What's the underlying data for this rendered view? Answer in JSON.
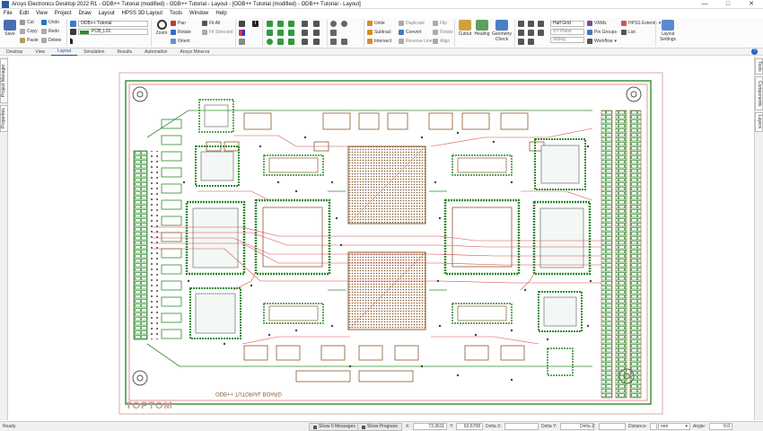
{
  "window": {
    "title": "Ansys Electronics Desktop 2022 R1 - ODB++ Tutorial (modified) - ODB++ Tutorial - Layout - [ODB++ Tutorial (modified) - ODB++ Tutorial - Layout]",
    "minimize": "—",
    "maximize": "□",
    "close": "✕"
  },
  "menu": [
    "File",
    "Edit",
    "View",
    "Project",
    "Draw",
    "Layout",
    "HPSS 3D Layout",
    "Tools",
    "Window",
    "Help"
  ],
  "ribbon": {
    "save": "Save",
    "cut": "Cut",
    "copy": "Copy",
    "paste": "Paste",
    "undo": "Undo",
    "redo": "Redo",
    "delete": "Delete",
    "design_select": "ODB++ Tutorial",
    "layer_select": "PCB_L01",
    "zoom": "Zoom",
    "pan": "Pan",
    "rotate": "Rotate",
    "orient": "Orient",
    "fit_all": "Fit All",
    "fit_selected": "Fit Selected",
    "unite": "Unite",
    "subtract": "Subtract",
    "intersect": "Intersect",
    "duplicate": "Duplicate",
    "convert": "Convert",
    "reverse_line": "Reverse Line",
    "flip": "Flip",
    "rotate2": "Rotate",
    "align": "Align",
    "cutout": "Cutout",
    "healing": "Healing",
    "geometry_check": "Geometry Check",
    "grid_select": "Half Grid",
    "xy_plane": "XY Plane",
    "angle": "90deg",
    "vrms": "VRMs",
    "pin_groups": "Pin Groups",
    "workflow": "Workflow",
    "hpss_extents": "HPSS Extents",
    "list": "List",
    "layout_settings": "Layout Settings"
  },
  "tabs": [
    "Desktop",
    "View",
    "Layout",
    "Simulation",
    "Results",
    "Automation",
    "Ansys Minerva"
  ],
  "active_tab": "Layout",
  "side_left": [
    "Project Manager",
    "Properties"
  ],
  "side_right": [
    "Tools",
    "Components",
    "Layers"
  ],
  "board": {
    "silk_text": "TOPTOM",
    "mirror_text": "ODB++ TUTORIAL BOARD"
  },
  "status": {
    "ready": "Ready",
    "show_messages": "Show 0 Messages",
    "show_progress": "Show Progress",
    "x_label": "X:",
    "x_value": "73.3611",
    "y_label": "Y:",
    "y_value": "62.6708",
    "dx_label": "Delta X:",
    "dx_value": "",
    "dy_label": "Delta Y:",
    "dy_value": "",
    "dz_label": "Delta Z:",
    "dz_value": "",
    "distance_label": "Distance:",
    "distance_value": "",
    "unit": "mm",
    "angle_label": "Angle:",
    "angle_value": "0.0"
  },
  "colors": {
    "board_copper": "#2e8b2e",
    "trace_red": "#d84a4a",
    "silk_brown": "#8b5a2b",
    "accent_blue": "#1a4f9c"
  }
}
